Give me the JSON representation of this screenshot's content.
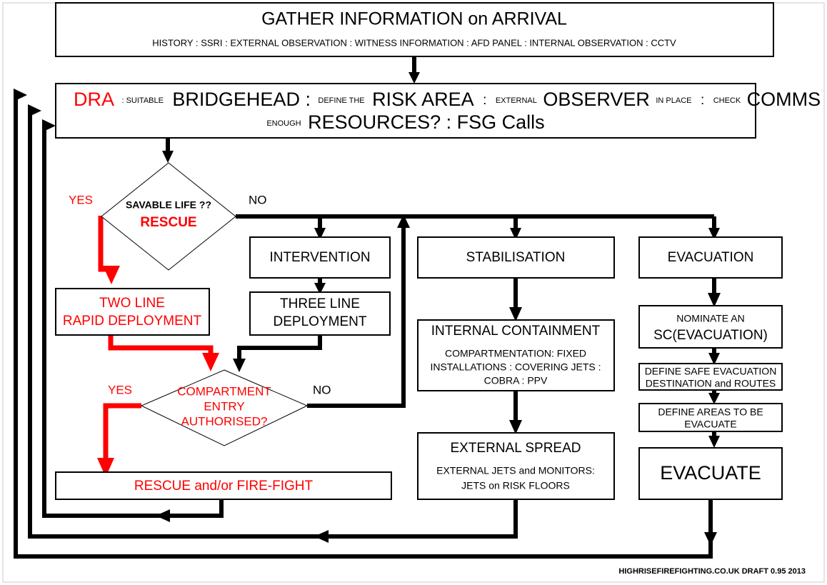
{
  "document": {
    "title": "High Rise Firefighting Operational Flowchart",
    "footer": "HIGHRISEFIREFIGHTING.CO.UK  DRAFT 0.95 2013"
  },
  "colors": {
    "accent_red": "#ff0000",
    "line_black": "#000000",
    "box_fill": "#ffffff",
    "frame": "#c8c8c8"
  },
  "nodes": {
    "gather": {
      "title": "GATHER INFORMATION on ARRIVAL",
      "detail": "HISTORY : SSRI :  EXTERNAL OBSERVATION  : WITNESS INFORMATION :  AFD PANEL : INTERNAL OBSERVATION : CCTV"
    },
    "dra": {
      "line1_a": "DRA",
      "line1_b": ": SUITABLE",
      "line1_c": "BRIDGEHEAD :",
      "line1_d": "DEFINE THE",
      "line1_e": "RISK AREA",
      "line1_f": ":",
      "line1_g": "EXTERNAL",
      "line1_h": "OBSERVER",
      "line1_i": "IN PLACE",
      "line1_j": ":",
      "line1_k": "CHECK",
      "line1_l": "COMMS",
      "line2_a": "ENOUGH",
      "line2_b": "RESOURCES?  :  FSG Calls"
    },
    "savable_life": {
      "question": "SAVABLE LIFE ??",
      "action": "RESCUE"
    },
    "two_line": {
      "line1": "TWO LINE",
      "line2": "RAPID DEPLOYMENT"
    },
    "intervention": {
      "title": "INTERVENTION"
    },
    "three_line": {
      "line1": "THREE LINE",
      "line2": "DEPLOYMENT"
    },
    "compartment": {
      "line1": "COMPARTMENT",
      "line2": "ENTRY",
      "line3": "AUTHORISED?"
    },
    "rescue_firefight": {
      "title": "RESCUE and/or FIRE-FIGHT"
    },
    "stabilisation": {
      "title": "STABILISATION"
    },
    "internal_containment": {
      "title": "INTERNAL CONTAINMENT",
      "detail1": "COMPARTMENTATION: FIXED",
      "detail2": "INSTALLATIONS : COVERING JETS :",
      "detail3": "COBRA : PPV"
    },
    "external_spread": {
      "title": "EXTERNAL SPREAD",
      "detail1": "EXTERNAL JETS and MONITORS:",
      "detail2": "JETS on RISK FLOORS"
    },
    "evacuation": {
      "title": "EVACUATION"
    },
    "nominate_sc": {
      "line1": "NOMINATE AN",
      "line2": "SC(EVACUATION)"
    },
    "define_safe": {
      "line1": "DEFINE SAFE EVACUATION",
      "line2": "DESTINATION and ROUTES"
    },
    "define_areas": {
      "line1": "DEFINE AREAS TO BE",
      "line2": "EVACUATE"
    },
    "evacuate": {
      "title": "EVACUATE"
    }
  },
  "edge_labels": {
    "savable_yes": "YES",
    "savable_no": "NO",
    "compartment_yes": "YES",
    "compartment_no": "NO"
  }
}
